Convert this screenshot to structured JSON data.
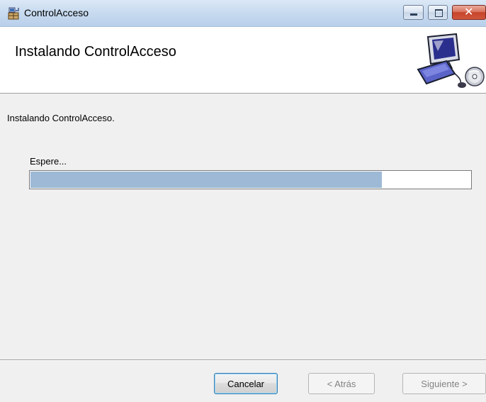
{
  "window": {
    "title": "ControlAcceso",
    "controls": {
      "minimize": "minimize-icon",
      "maximize": "maximize-icon",
      "close": "close-icon"
    }
  },
  "header": {
    "title": "Instalando ControlAcceso",
    "graphic": "computer-install-icon"
  },
  "main": {
    "status_text": "Instalando ControlAcceso.",
    "progress_label": "Espere...",
    "progress_fraction": 0.8,
    "progress_fill_color": "#9db9d6"
  },
  "footer": {
    "cancel_label": "Cancelar",
    "back_label": "< Atrás",
    "next_label": "Siguiente >",
    "back_enabled": false,
    "next_enabled": false
  },
  "colors": {
    "titlebar": "#c7daef",
    "close_button": "#c6452b",
    "dialog_background": "#f0f0f0",
    "header_background": "#ffffff"
  }
}
